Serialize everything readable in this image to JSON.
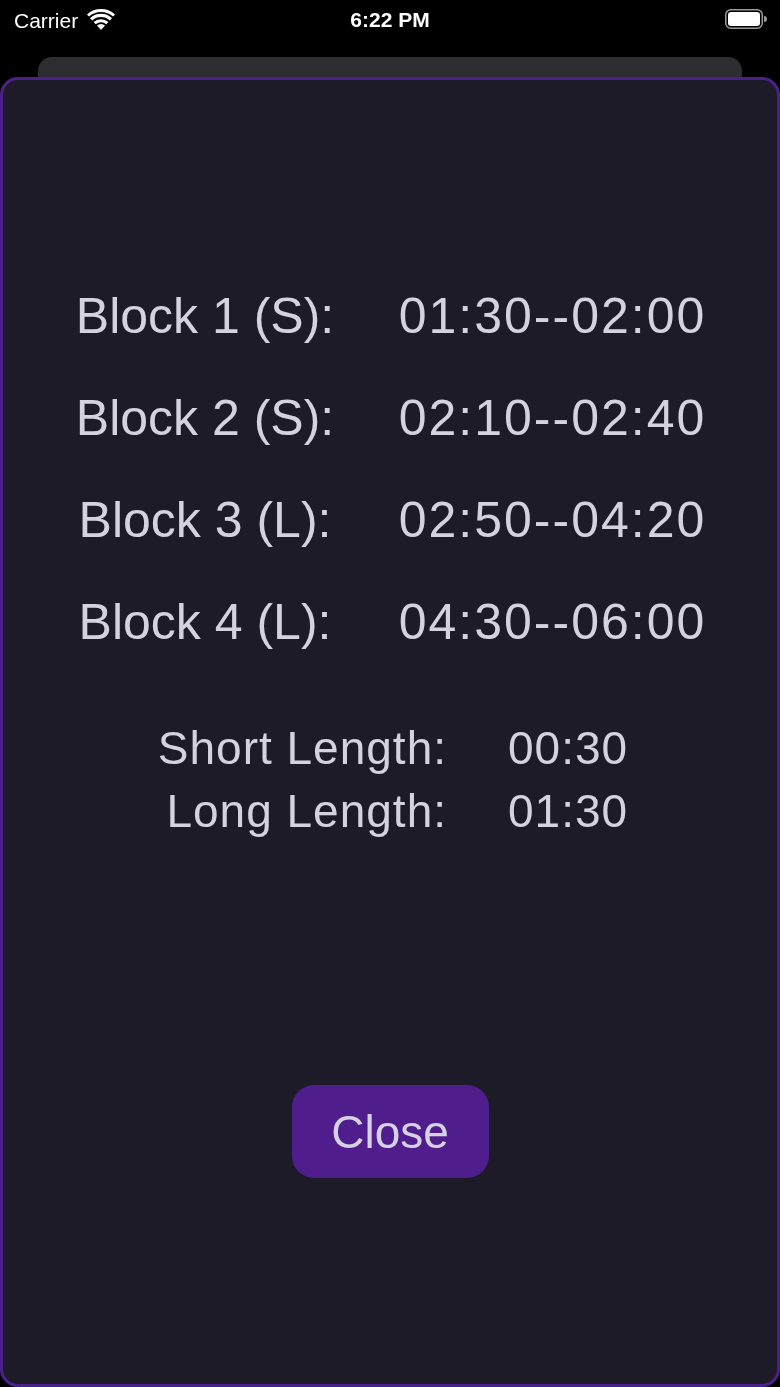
{
  "status_bar": {
    "carrier": "Carrier",
    "time": "6:22 PM"
  },
  "blocks": [
    {
      "label": "Block 1 (S):",
      "time_range": "01:30--02:00"
    },
    {
      "label": "Block 2 (S):",
      "time_range": "02:10--02:40"
    },
    {
      "label": "Block 3 (L):",
      "time_range": "02:50--04:20"
    },
    {
      "label": "Block 4 (L):",
      "time_range": "04:30--06:00"
    }
  ],
  "lengths": [
    {
      "label": "Short Length:",
      "value": "00:30"
    },
    {
      "label": "Long Length:",
      "value": "01:30"
    }
  ],
  "close_button": {
    "label": "Close"
  }
}
